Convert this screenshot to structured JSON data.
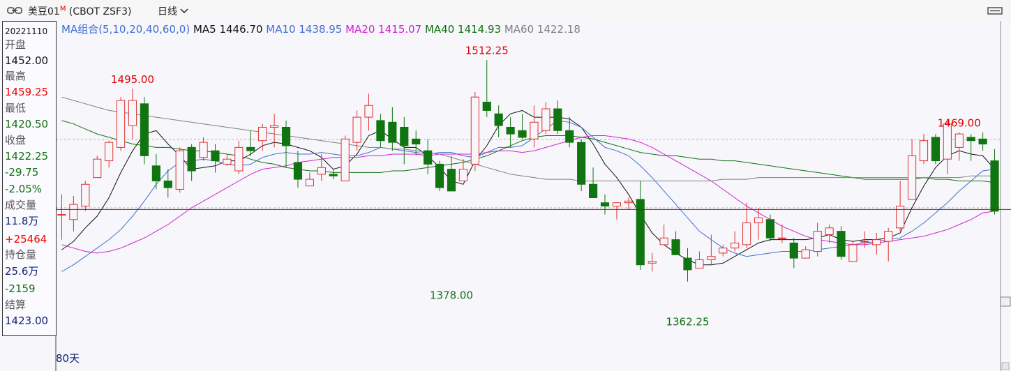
{
  "title": {
    "name": "美豆01",
    "marker": "M",
    "code": "(CBOT ZSF3)",
    "period": "日线"
  },
  "legend": {
    "group": "MA组合(5,10,20,40,60,0)",
    "items": [
      {
        "text": "MA5 1446.70",
        "color": "#111111"
      },
      {
        "text": "MA10 1438.95",
        "color": "#3f6fd0"
      },
      {
        "text": "MA20 1415.07",
        "color": "#d020d0"
      },
      {
        "text": "MA40 1414.93",
        "color": "#107010"
      },
      {
        "text": "MA60 1422.18",
        "color": "#808080"
      }
    ]
  },
  "info": {
    "date": "20221110",
    "open_label": "开盘",
    "open": "1452.00",
    "high_label": "最高",
    "high": "1459.25",
    "low_label": "最低",
    "low": "1420.50",
    "close_label": "收盘",
    "close": "1422.25",
    "change": "-29.75",
    "change_pct": "-2.05%",
    "volume_label": "成交量",
    "volume": "11.8万",
    "volume_change": "+25464",
    "oi_label": "持仓量",
    "oi": "25.6万",
    "oi_change": "-2159",
    "settle_label": "结算",
    "settle": "1423.00"
  },
  "footer": {
    "days": "80天"
  },
  "colors": {
    "up": "#e03030",
    "down": "#107510",
    "bg": "#f7f6fb",
    "crosshair": "#8b1a1a"
  },
  "chart_data": {
    "type": "candlestick",
    "y_range": [
      1340,
      1525
    ],
    "crosshair_y": 1423,
    "annotations": [
      {
        "text": "1495.00",
        "index": 6,
        "value": 1495,
        "type": "high"
      },
      {
        "text": "1512.25",
        "index": 36,
        "value": 1512.25,
        "type": "high"
      },
      {
        "text": "1378.00",
        "index": 33,
        "value": 1378,
        "type": "low"
      },
      {
        "text": "1362.25",
        "index": 53,
        "value": 1362.25,
        "type": "low"
      },
      {
        "text": "1469.00",
        "index": 76,
        "value": 1469,
        "type": "high"
      }
    ],
    "ohlc": [
      [
        1420,
        1420,
        1405,
        1432
      ],
      [
        1417,
        1426,
        1410,
        1431
      ],
      [
        1425,
        1438,
        1422,
        1440
      ],
      [
        1442,
        1453,
        1442,
        1455
      ],
      [
        1452,
        1463,
        1448,
        1464
      ],
      [
        1460,
        1488,
        1458,
        1490
      ],
      [
        1473,
        1488,
        1465,
        1495
      ],
      [
        1486,
        1455,
        1450,
        1490
      ],
      [
        1449,
        1440,
        1435,
        1456
      ],
      [
        1440,
        1436,
        1430,
        1447
      ],
      [
        1435,
        1458,
        1433,
        1460
      ],
      [
        1460,
        1446,
        1440,
        1462
      ],
      [
        1454,
        1463,
        1452,
        1466
      ],
      [
        1458,
        1452,
        1445,
        1462
      ],
      [
        1450,
        1453,
        1449,
        1456
      ],
      [
        1446,
        1460,
        1444,
        1464
      ],
      [
        1460,
        1458,
        1455,
        1470
      ],
      [
        1464,
        1472,
        1458,
        1474
      ],
      [
        1472,
        1473,
        1460,
        1480
      ],
      [
        1472,
        1461,
        1448,
        1476
      ],
      [
        1451,
        1441,
        1436,
        1458
      ],
      [
        1437,
        1441,
        1437,
        1445
      ],
      [
        1444,
        1448,
        1440,
        1456
      ],
      [
        1444,
        1443,
        1441,
        1447
      ],
      [
        1440,
        1465,
        1442,
        1467
      ],
      [
        1463,
        1478,
        1458,
        1482
      ],
      [
        1478,
        1485,
        1470,
        1492
      ],
      [
        1476,
        1464,
        1460,
        1480
      ],
      [
        1475,
        1463,
        1458,
        1484
      ],
      [
        1472,
        1461,
        1450,
        1478
      ],
      [
        1465,
        1462,
        1455,
        1470
      ],
      [
        1458,
        1450,
        1444,
        1465
      ],
      [
        1450,
        1436,
        1434,
        1452
      ],
      [
        1447,
        1434,
        1434,
        1455
      ],
      [
        1440,
        1447,
        1440,
        1453
      ],
      [
        1450,
        1490,
        1446,
        1493
      ],
      [
        1487,
        1482,
        1478,
        1512
      ],
      [
        1480,
        1473,
        1466,
        1485
      ],
      [
        1472,
        1468,
        1460,
        1478
      ],
      [
        1470,
        1466,
        1465,
        1480
      ],
      [
        1465,
        1475,
        1460,
        1485
      ],
      [
        1470,
        1483,
        1468,
        1487
      ],
      [
        1483,
        1470,
        1468,
        1488
      ],
      [
        1470,
        1463,
        1460,
        1478
      ],
      [
        1463,
        1438,
        1434,
        1465
      ],
      [
        1438,
        1430,
        1430,
        1448
      ],
      [
        1427,
        1425,
        1420,
        1432
      ],
      [
        1425,
        1427,
        1417,
        1427
      ],
      [
        1427,
        1428,
        1423,
        1430
      ],
      [
        1429,
        1390,
        1387,
        1440
      ],
      [
        1391,
        1392,
        1386,
        1397
      ],
      [
        1402,
        1406,
        1402,
        1414
      ],
      [
        1405,
        1396,
        1396,
        1410
      ],
      [
        1394,
        1387,
        1380,
        1400
      ],
      [
        1388,
        1393,
        1390,
        1398
      ],
      [
        1393,
        1395,
        1390,
        1408
      ],
      [
        1397,
        1400,
        1395,
        1402
      ],
      [
        1400,
        1403,
        1398,
        1410
      ],
      [
        1402,
        1415,
        1400,
        1427
      ],
      [
        1415,
        1418,
        1405,
        1424
      ],
      [
        1417,
        1406,
        1404,
        1420
      ],
      [
        1406,
        1406,
        1403,
        1414
      ],
      [
        1403,
        1394,
        1388,
        1406
      ],
      [
        1394,
        1399,
        1394,
        1401
      ],
      [
        1398,
        1410,
        1395,
        1415
      ],
      [
        1408,
        1412,
        1403,
        1414
      ],
      [
        1410,
        1395,
        1393,
        1413
      ],
      [
        1392,
        1402,
        1392,
        1404
      ],
      [
        1404,
        1404,
        1400,
        1410
      ],
      [
        1402,
        1405,
        1396,
        1409
      ],
      [
        1404,
        1410,
        1392,
        1412
      ],
      [
        1412,
        1425,
        1410,
        1440
      ],
      [
        1429,
        1455,
        1429,
        1465
      ],
      [
        1452,
        1464,
        1450,
        1468
      ],
      [
        1466,
        1452,
        1450,
        1468
      ],
      [
        1453,
        1474,
        1444,
        1477
      ],
      [
        1460,
        1468,
        1452,
        1469
      ],
      [
        1466,
        1464,
        1452,
        1468
      ],
      [
        1465,
        1462,
        1458,
        1469
      ],
      [
        1452,
        1422,
        1420,
        1459
      ]
    ],
    "ma": {
      "MA5": [
        1399,
        1404,
        1412,
        1419,
        1430,
        1445,
        1458,
        1468,
        1470,
        1462,
        1455,
        1447,
        1448,
        1449,
        1452,
        1452,
        1456,
        1461,
        1463,
        1462,
        1460,
        1458,
        1454,
        1447,
        1449,
        1456,
        1467,
        1470,
        1465,
        1460,
        1460,
        1455,
        1448,
        1440,
        1438,
        1452,
        1461,
        1473,
        1480,
        1482,
        1478,
        1478,
        1478,
        1477,
        1472,
        1462,
        1450,
        1442,
        1432,
        1420,
        1409,
        1402,
        1397,
        1393,
        1390,
        1390,
        1391,
        1395,
        1399,
        1403,
        1405,
        1405,
        1405,
        1405,
        1406,
        1408,
        1405,
        1404,
        1405,
        1405,
        1406,
        1409,
        1424,
        1437,
        1448,
        1455,
        1458,
        1456,
        1455,
        1447
      ],
      "MA10": [
        1386,
        1390,
        1395,
        1400,
        1405,
        1411,
        1419,
        1428,
        1438,
        1446,
        1451,
        1452,
        1453,
        1452,
        1450,
        1449,
        1450,
        1454,
        1456,
        1457,
        1456,
        1456,
        1457,
        1456,
        1455,
        1455,
        1457,
        1460,
        1459,
        1458,
        1457,
        1456,
        1457,
        1457,
        1455,
        1454,
        1457,
        1460,
        1460,
        1461,
        1466,
        1471,
        1476,
        1475,
        1472,
        1466,
        1460,
        1458,
        1455,
        1449,
        1442,
        1434,
        1426,
        1418,
        1410,
        1405,
        1400,
        1397,
        1395,
        1396,
        1397,
        1398,
        1398,
        1398,
        1399,
        1400,
        1401,
        1402,
        1403,
        1404,
        1405,
        1406,
        1410,
        1415,
        1421,
        1427,
        1434,
        1440,
        1446,
        1447
      ],
      "MA20": [
        1402,
        1400,
        1398,
        1397,
        1398,
        1400,
        1403,
        1406,
        1410,
        1414,
        1419,
        1424,
        1428,
        1432,
        1436,
        1440,
        1444,
        1447,
        1448,
        1449,
        1451,
        1452,
        1453,
        1454,
        1454,
        1454,
        1455,
        1455,
        1456,
        1456,
        1456,
        1455,
        1456,
        1456,
        1456,
        1456,
        1457,
        1458,
        1458,
        1457,
        1458,
        1460,
        1462,
        1464,
        1466,
        1467,
        1467,
        1466,
        1465,
        1463,
        1460,
        1456,
        1452,
        1448,
        1444,
        1440,
        1435,
        1430,
        1425,
        1421,
        1417,
        1413,
        1410,
        1407,
        1405,
        1404,
        1403,
        1402,
        1402,
        1403,
        1404,
        1405,
        1406,
        1407,
        1409,
        1411,
        1414,
        1417,
        1421,
        1422
      ],
      "MA40": [
        1476,
        1474,
        1471,
        1468,
        1466,
        1464,
        1462,
        1461,
        1460,
        1460,
        1459,
        1458,
        1458,
        1457,
        1456,
        1455,
        1453,
        1451,
        1450,
        1448,
        1447,
        1446,
        1446,
        1445,
        1445,
        1445,
        1445,
        1445,
        1446,
        1446,
        1447,
        1448,
        1449,
        1450,
        1451,
        1453,
        1455,
        1458,
        1461,
        1464,
        1466,
        1467,
        1467,
        1467,
        1466,
        1465,
        1463,
        1461,
        1459,
        1457,
        1456,
        1455,
        1455,
        1454,
        1453,
        1453,
        1452,
        1452,
        1451,
        1450,
        1449,
        1448,
        1447,
        1446,
        1445,
        1444,
        1443,
        1442,
        1441,
        1441,
        1441,
        1441,
        1441,
        1442,
        1441,
        1441,
        1440,
        1440,
        1440,
        1439
      ],
      "MA60": [
        1490,
        1488,
        1486,
        1484,
        1482,
        1481,
        1480,
        1479,
        1478,
        1477,
        1476,
        1475,
        1474,
        1473,
        1472,
        1471,
        1470,
        1469,
        1468,
        1467,
        1466,
        1465,
        1464,
        1463,
        1462,
        1461,
        1460,
        1460,
        1459,
        1459,
        1458,
        1457,
        1456,
        1454,
        1452,
        1450,
        1448,
        1446,
        1444,
        1443,
        1442,
        1441,
        1441,
        1441,
        1440,
        1440,
        1440,
        1440,
        1440,
        1440,
        1440,
        1440,
        1440,
        1440,
        1440,
        1440,
        1441,
        1441,
        1441,
        1442,
        1442,
        1442,
        1442,
        1442,
        1442,
        1442,
        1442,
        1442,
        1442,
        1442,
        1442,
        1442,
        1442,
        1442,
        1442,
        1442,
        1442,
        1443,
        1443,
        1443
      ]
    }
  }
}
